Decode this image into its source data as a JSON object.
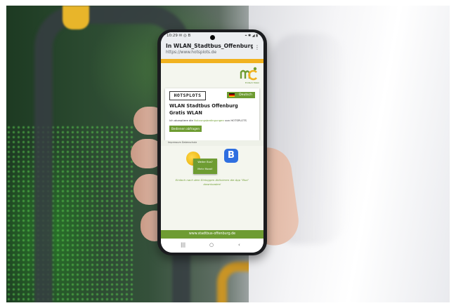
{
  "status_bar": {
    "time": "10:29 ✉ ◎ B",
    "indicators": "⌖ ✱ ◢ ▮"
  },
  "browser": {
    "page_title": "In WLAN_Stadtbus_Offenburg an...",
    "page_url": "https://www.hotsplots.de",
    "menu_icon": "more-vert-icon"
  },
  "portal": {
    "logo_sub": "Einfach Mobil",
    "hotsplots_logo": "HOTSPLOTS",
    "language_label": "Deutsch",
    "title": "WLAN Stadtbus Offenburg",
    "subtitle": "Gratis WLAN",
    "accept_prefix": "Ich akzeptiere die ",
    "accept_link": "Nutzungsbedingungen",
    "accept_suffix": " von HOTSPLOTS",
    "accept_button": "Bedienen abfragen",
    "footer_links": "Impressum   Datenschutz",
    "promo_q1": "Weiter Bus?",
    "promo_q2": "Mehr Mond!",
    "app_icon_letter": "B",
    "promo_text_line1": "Einfach nach dem Einloggen Aktivieren die App \"Bus\"",
    "promo_text_line2": "downloaden!",
    "bottom_url": "www.stadtbus-offenburg.de"
  },
  "nav_bar": {
    "recents": "|||",
    "home": "○",
    "back": "‹"
  },
  "colors": {
    "brand_green": "#6e9c32",
    "accent_orange": "#f1b21f",
    "app_blue": "#2f6fe0"
  }
}
